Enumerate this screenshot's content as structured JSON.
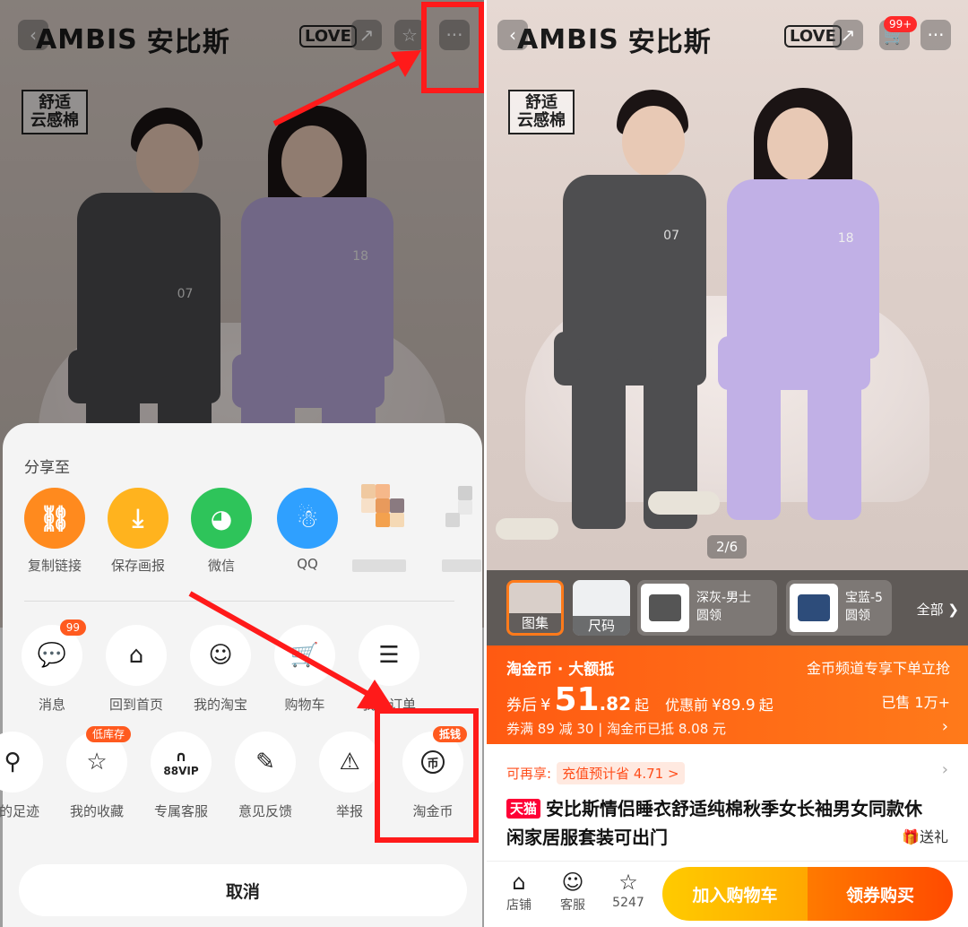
{
  "brand": {
    "logo_text": "AMBIS",
    "name_cn": "安比斯",
    "love_tag": "LOVE",
    "comfort_badge": "舒适\n云感棉",
    "number_man": "07",
    "number_woman": "18"
  },
  "left_panel": {
    "share_title": "分享至",
    "share_targets": [
      {
        "label": "复制链接",
        "icon": "link-icon",
        "color": "#ff8a1e"
      },
      {
        "label": "保存画报",
        "icon": "download-icon",
        "color": "#ffb31e"
      },
      {
        "label": "微信",
        "icon": "wechat-icon",
        "color": "#2ec45a"
      },
      {
        "label": "QQ",
        "icon": "qq-penguin-icon",
        "color": "#2fa0ff"
      }
    ],
    "menu_row1": [
      {
        "label": "消息",
        "icon": "chat-bubble-icon",
        "badge": "99"
      },
      {
        "label": "回到首页",
        "icon": "home-icon",
        "badge": ""
      },
      {
        "label": "我的淘宝",
        "icon": "smile-icon",
        "badge": ""
      },
      {
        "label": "购物车",
        "icon": "cart-icon",
        "badge": ""
      },
      {
        "label": "我的订单",
        "icon": "order-list-icon",
        "badge": ""
      }
    ],
    "menu_row2": [
      {
        "label": "我的足迹",
        "icon": "footprint-icon",
        "badge": ""
      },
      {
        "label": "我的收藏",
        "icon": "star-icon",
        "badge": "低库存"
      },
      {
        "label": "专属客服",
        "icon": "headset-88vip-icon",
        "badge": "",
        "inner": "88VIP"
      },
      {
        "label": "意见反馈",
        "icon": "edit-icon",
        "badge": ""
      },
      {
        "label": "举报",
        "icon": "warning-icon",
        "badge": ""
      },
      {
        "label": "淘金币",
        "icon": "coin-icon",
        "badge": "抵钱",
        "inner": "币"
      }
    ],
    "cancel_label": "取消"
  },
  "right_panel": {
    "cart_badge": "99+",
    "image_counter": "2/6",
    "thumbs": [
      {
        "label": "图集"
      },
      {
        "label": "尺码"
      }
    ],
    "variants": [
      {
        "line1": "深灰-男士",
        "line2": "圆领"
      },
      {
        "line1": "宝蓝-5",
        "line2": "圆领"
      }
    ],
    "all_label": "全部",
    "promo": {
      "title": "淘金币 · 大额抵",
      "right_note": "金币频道专享下单立抢",
      "after_coupon": "券后",
      "currency": "¥",
      "price_int": "51",
      "price_dec": ".82",
      "price_suffix": "起",
      "orig_prefix": "优惠前",
      "orig_price": "¥89.9",
      "orig_suffix": "起",
      "sold": "已售 1万+",
      "coupon_line": "券满 89 减 30 | 淘金币已抵 8.08 元"
    },
    "reshare_label": "可再享:",
    "recharge_label": "充值预计省 4.71 >",
    "tmall_tag": "天猫",
    "product_title": "安比斯情侣睡衣舒适纯棉秋季女长袖男女同款休闲家居服套装可出门",
    "gift_label": "送礼",
    "bottom_bar": {
      "store": "店铺",
      "service": "客服",
      "fav_count": "5247",
      "add_cart": "加入购物车",
      "buy": "领券购买"
    }
  },
  "colors": {
    "accent": "#ff5a12",
    "highlight_red": "#ff1a1a"
  }
}
